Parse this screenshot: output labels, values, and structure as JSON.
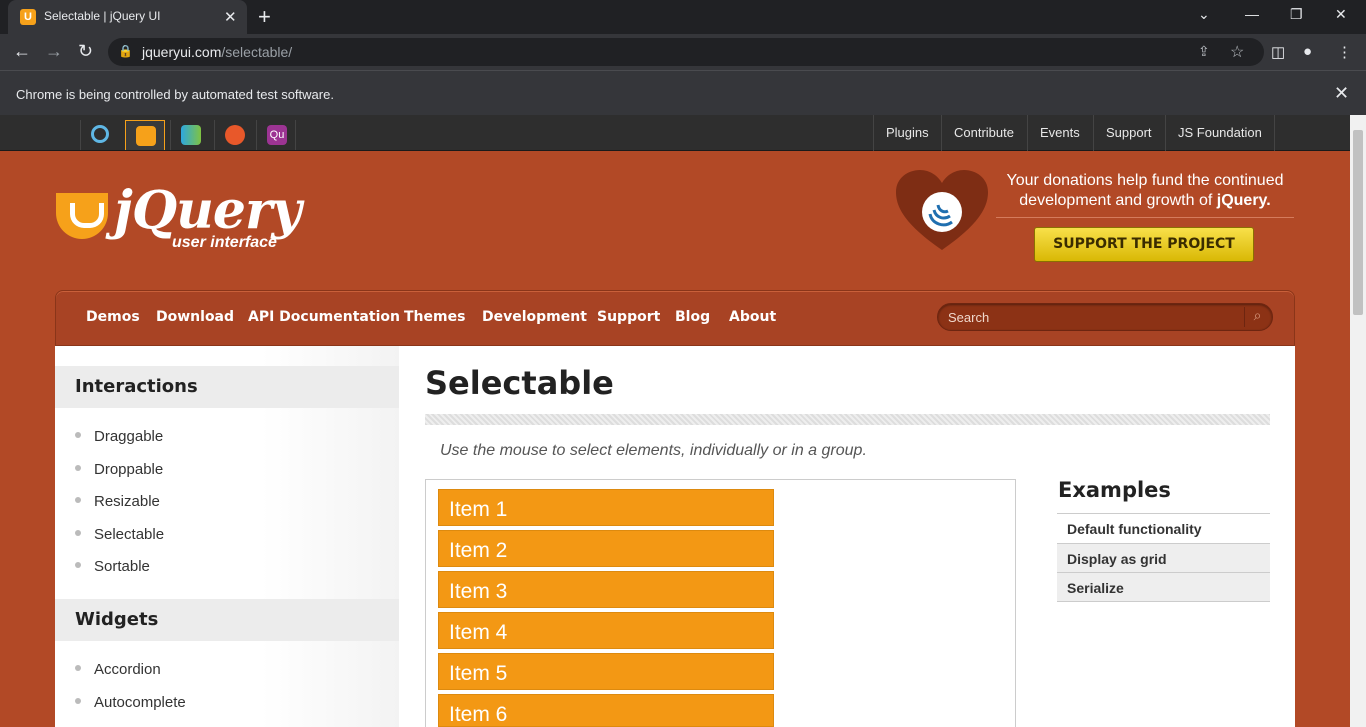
{
  "browser": {
    "tab_title": "Selectable | jQuery UI",
    "url_host": "jqueryui.com",
    "url_path": "/selectable/",
    "infobar_message": "Chrome is being controlled by automated test software."
  },
  "global_nav": {
    "links": [
      "Plugins",
      "Contribute",
      "Events",
      "Support",
      "JS Foundation"
    ]
  },
  "header": {
    "logo_text": "jQuery",
    "logo_sub": "user interface",
    "donate_text": "Your donations help fund the continued development and growth of",
    "donate_brand": "jQuery.",
    "support_button": "SUPPORT THE PROJECT"
  },
  "main_nav": {
    "items": [
      "Demos",
      "Download",
      "API Documentation",
      "Themes",
      "Development",
      "Support",
      "Blog",
      "About"
    ],
    "search_placeholder": "Search"
  },
  "sidebar": {
    "interactions_title": "Interactions",
    "interactions": [
      "Draggable",
      "Droppable",
      "Resizable",
      "Selectable",
      "Sortable"
    ],
    "widgets_title": "Widgets",
    "widgets": [
      "Accordion",
      "Autocomplete"
    ]
  },
  "main": {
    "title": "Selectable",
    "description": "Use the mouse to select elements, individually or in a group.",
    "items": [
      "Item 1",
      "Item 2",
      "Item 3",
      "Item 4",
      "Item 5",
      "Item 6"
    ],
    "examples_title": "Examples",
    "examples": [
      "Default functionality",
      "Display as grid",
      "Serialize"
    ]
  }
}
